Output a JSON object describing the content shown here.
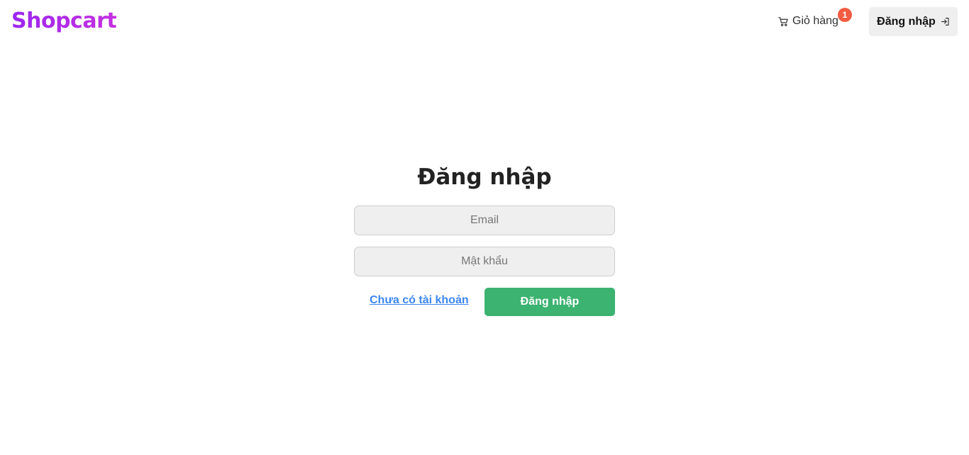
{
  "header": {
    "logo": "Shopcart",
    "cart_label": "Giỏ hàng",
    "cart_count": "1",
    "cart_icon": "cart-icon",
    "login_label": "Đăng nhập",
    "login_icon": "sign-in-icon"
  },
  "form": {
    "title": "Đăng nhập",
    "email_placeholder": "Email",
    "email_value": "",
    "password_placeholder": "Mật khẩu",
    "password_value": "",
    "register_link": "Chưa có tài khoản",
    "submit_label": "Đăng nhập"
  },
  "colors": {
    "logo_gradient_start": "#9b27ee",
    "logo_gradient_end": "#c52fe0",
    "badge": "#f25c42",
    "submit_button": "#3cb371",
    "link": "#3b86f0",
    "input_background": "#efefef"
  }
}
